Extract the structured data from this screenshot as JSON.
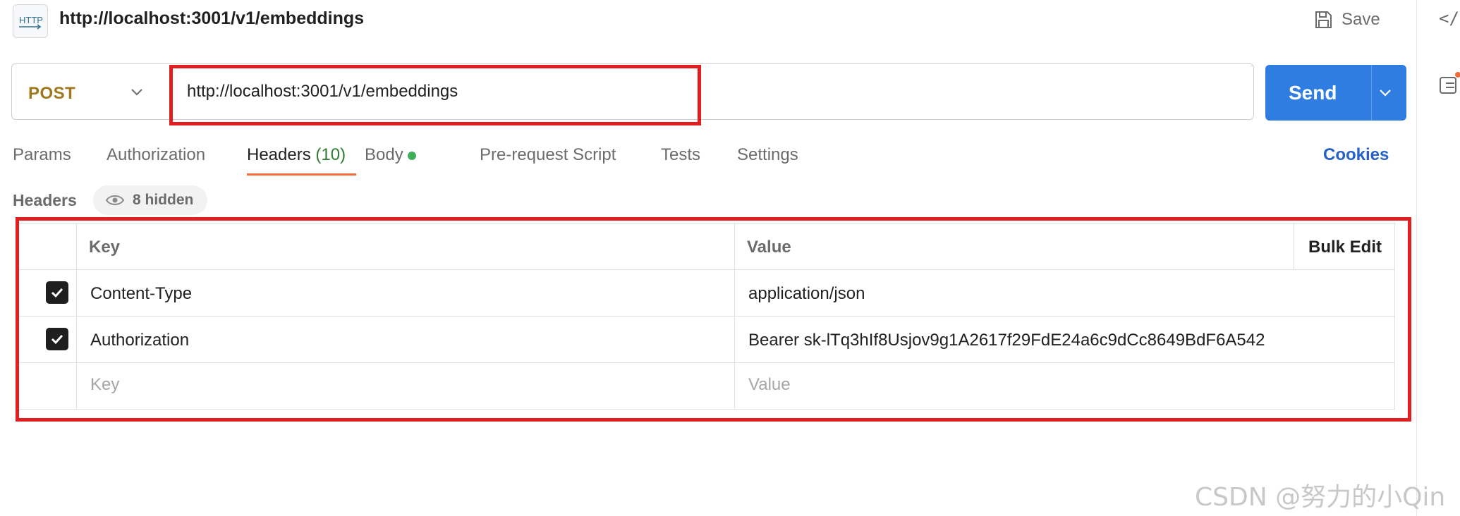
{
  "header": {
    "title": "http://localhost:3001/v1/embeddings",
    "http_icon_text": "HTTP",
    "save_label": "Save"
  },
  "request": {
    "method": "POST",
    "method_color": "#a0781c",
    "url": "http://localhost:3001/v1/embeddings",
    "send_label": "Send",
    "send_color": "#2f7de1"
  },
  "tabs": [
    {
      "label": "Params"
    },
    {
      "label": "Authorization"
    },
    {
      "label": "Headers",
      "count": "(10)",
      "active": true
    },
    {
      "label": "Body",
      "has_content_dot": true
    },
    {
      "label": "Pre-request Script"
    },
    {
      "label": "Tests"
    },
    {
      "label": "Settings"
    }
  ],
  "cookies_label": "Cookies",
  "headers_section": {
    "title": "Headers",
    "hidden_label": "8 hidden"
  },
  "table": {
    "columns": {
      "key": "Key",
      "value": "Value",
      "bulk_edit": "Bulk Edit"
    },
    "rows": [
      {
        "checked": true,
        "key": "Content-Type",
        "value": "application/json"
      },
      {
        "checked": true,
        "key": "Authorization",
        "value": "Bearer sk-lTq3hIf8Usjov9g1A2617f29FdE24a6c9dCc8649BdF6A542"
      }
    ],
    "placeholder": {
      "key": "Key",
      "value": "Value"
    }
  },
  "watermark": "CSDN @努力的小Qin",
  "highlight_color": "#e02020",
  "icons": [
    "http-icon",
    "save-icon",
    "code-icon",
    "chevron-down-icon",
    "eye-icon",
    "checkbox-checked-icon"
  ]
}
